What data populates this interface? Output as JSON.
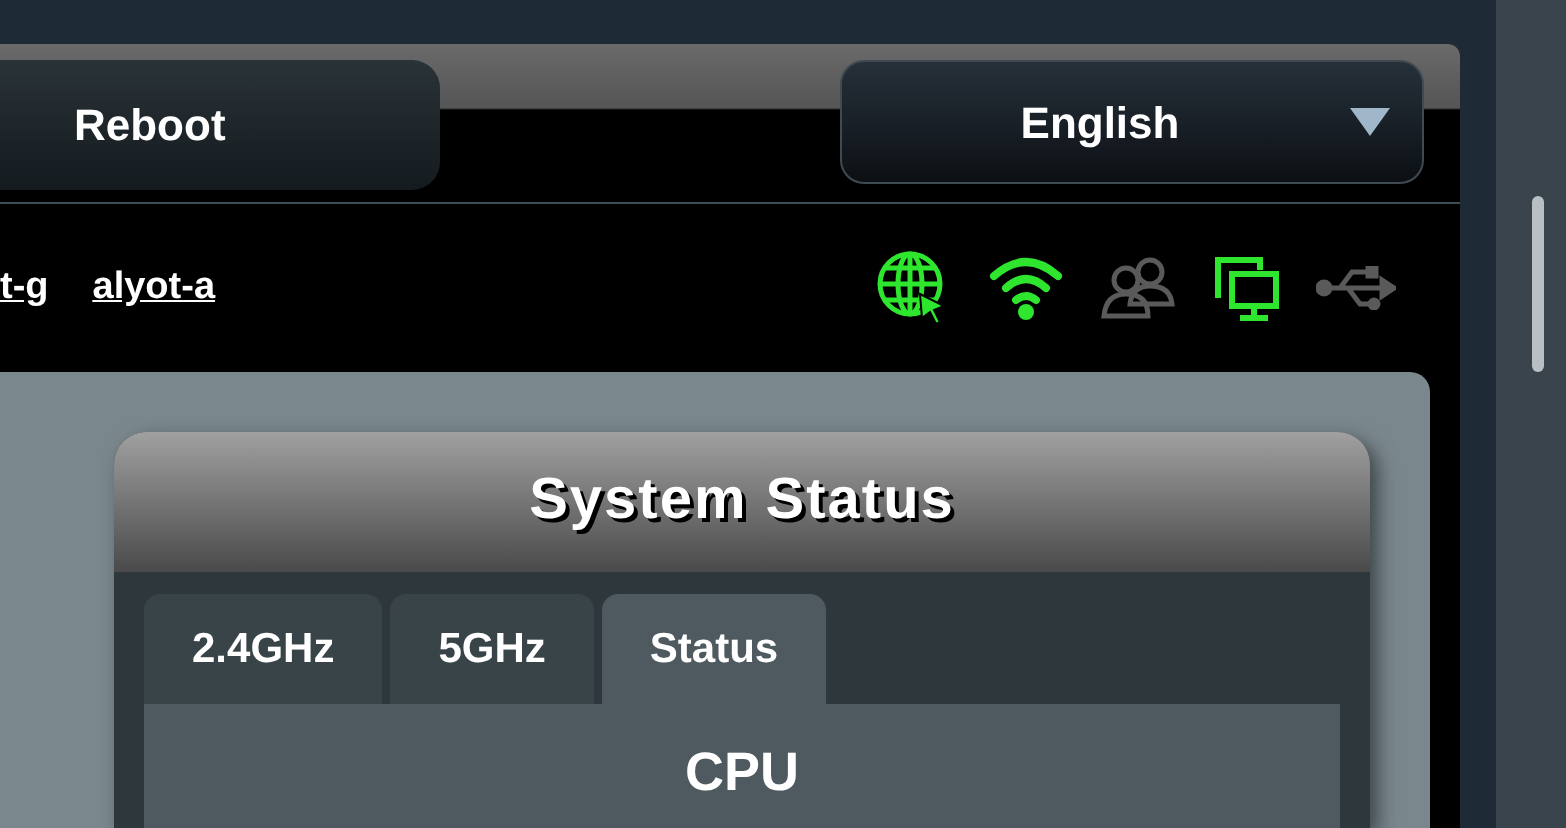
{
  "header": {
    "reboot_button": "Reboot",
    "language": {
      "value": "English"
    }
  },
  "links": [
    "t-g",
    "alyot-a"
  ],
  "status_icons": [
    {
      "kind": "internet",
      "on": true
    },
    {
      "kind": "wifi",
      "on": true
    },
    {
      "kind": "clients",
      "on": false
    },
    {
      "kind": "devices",
      "on": true
    },
    {
      "kind": "usb",
      "on": false
    }
  ],
  "panel": {
    "title": "System Status",
    "tabs": [
      {
        "label": "2.4GHz",
        "selected": false
      },
      {
        "label": "5GHz",
        "selected": false
      },
      {
        "label": "Status",
        "selected": true
      }
    ],
    "section_title": "CPU"
  }
}
